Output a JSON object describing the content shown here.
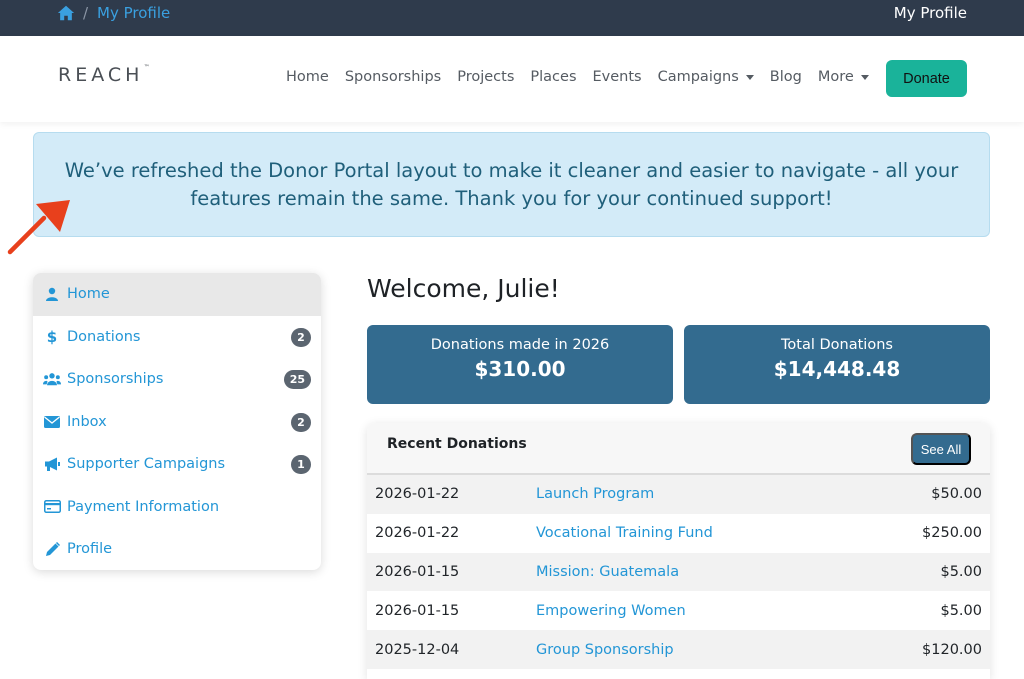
{
  "topbar": {
    "breadcrumb_current": "My Profile",
    "breadcrumb_separator": "/",
    "right_label": "My Profile"
  },
  "navbar": {
    "logo": "REACH",
    "logo_mark": "™",
    "items": [
      {
        "label": "Home",
        "dropdown": false
      },
      {
        "label": "Sponsorships",
        "dropdown": false
      },
      {
        "label": "Projects",
        "dropdown": false
      },
      {
        "label": "Places",
        "dropdown": false
      },
      {
        "label": "Events",
        "dropdown": false
      },
      {
        "label": "Campaigns",
        "dropdown": true
      },
      {
        "label": "Blog",
        "dropdown": false
      },
      {
        "label": "More",
        "dropdown": true
      }
    ],
    "donate_label": "Donate"
  },
  "notice": {
    "text": "We’ve refreshed the Donor Portal layout to make it cleaner and easier to navigate - all your features remain the same. Thank you for your continued support!"
  },
  "sidebar": {
    "items": [
      {
        "label": "Home",
        "icon": "user-icon",
        "badge": ""
      },
      {
        "label": "Donations",
        "icon": "dollar-icon",
        "badge": "2"
      },
      {
        "label": "Sponsorships",
        "icon": "users-icon",
        "badge": "25"
      },
      {
        "label": "Inbox",
        "icon": "envelope-icon",
        "badge": "2"
      },
      {
        "label": "Supporter Campaigns",
        "icon": "megaphone-icon",
        "badge": "1"
      },
      {
        "label": "Payment Information",
        "icon": "credit-card-icon",
        "badge": ""
      },
      {
        "label": "Profile",
        "icon": "pencil-icon",
        "badge": ""
      }
    ]
  },
  "main": {
    "welcome": "Welcome, Julie!",
    "stats": [
      {
        "label": "Donations made in 2026",
        "value": "$310.00"
      },
      {
        "label": "Total Donations",
        "value": "$14,448.48"
      }
    ],
    "recent": {
      "title": "Recent Donations",
      "see_all": "See All",
      "rows": [
        {
          "date": "2026-01-22",
          "fund": "Launch Program",
          "amount": "$50.00"
        },
        {
          "date": "2026-01-22",
          "fund": "Vocational Training Fund",
          "amount": "$250.00"
        },
        {
          "date": "2026-01-15",
          "fund": "Mission: Guatemala",
          "amount": "$5.00"
        },
        {
          "date": "2026-01-15",
          "fund": "Empowering Women",
          "amount": "$5.00"
        },
        {
          "date": "2025-12-04",
          "fund": "Group Sponsorship",
          "amount": "$120.00"
        }
      ]
    }
  },
  "colors": {
    "topbar": "#2f3b4c",
    "link": "#2396d6",
    "donate": "#1ab39a",
    "stat_card": "#336b8f",
    "notice_bg": "#d3ebf8",
    "notice_text": "#1f5f7a",
    "annotation_arrow": "#e8401c"
  }
}
